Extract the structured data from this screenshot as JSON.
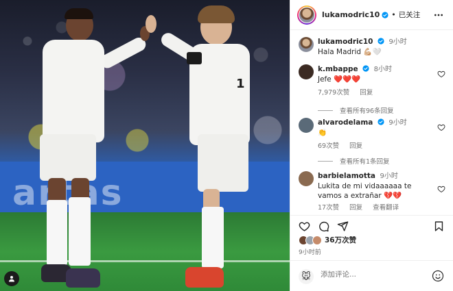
{
  "post": {
    "author": "lukamodric10",
    "follow_label": "已关注",
    "more_label": "更多选项",
    "board_text": "artas"
  },
  "caption": {
    "user": "lukamodric10",
    "time": "9小时",
    "text": "Hala Madrid 💪🏼🤍"
  },
  "comments": [
    {
      "user": "k.mbappe",
      "time": "8小时",
      "text": "Jefe ❤️❤️❤️",
      "likes": "7,979次赞",
      "reply": "回复",
      "view_replies": "查看所有96条回复",
      "verified": true,
      "avatar_color": "#3b2a22"
    },
    {
      "user": "alvarodelama",
      "time": "9小时",
      "text": "👏",
      "likes": "69次赞",
      "reply": "回复",
      "view_replies": "查看所有1条回复",
      "verified": true,
      "avatar_color": "#5a6a78"
    },
    {
      "user": "barbielamotta",
      "time": "9小时",
      "text": "Lukita de mi vidaaaaaa te vamos a extrañar 💔💔",
      "likes": "17次赞",
      "reply": "回复",
      "translate": "查看翻译",
      "verified": false,
      "avatar_color": "#8a6a50"
    }
  ],
  "actions": {
    "like_icon": "heart-icon",
    "comment_icon": "comment-icon",
    "share_icon": "share-icon",
    "save_icon": "bookmark-icon"
  },
  "likes_count": "36万次赞",
  "posted_time": "9小时前",
  "add_comment": {
    "placeholder": "添加评论...",
    "emoji_icon": "emoji-icon"
  },
  "colors": {
    "verified_blue": "#0095f6",
    "text_primary": "#262626",
    "text_secondary": "#737373",
    "divider": "#efefef"
  }
}
